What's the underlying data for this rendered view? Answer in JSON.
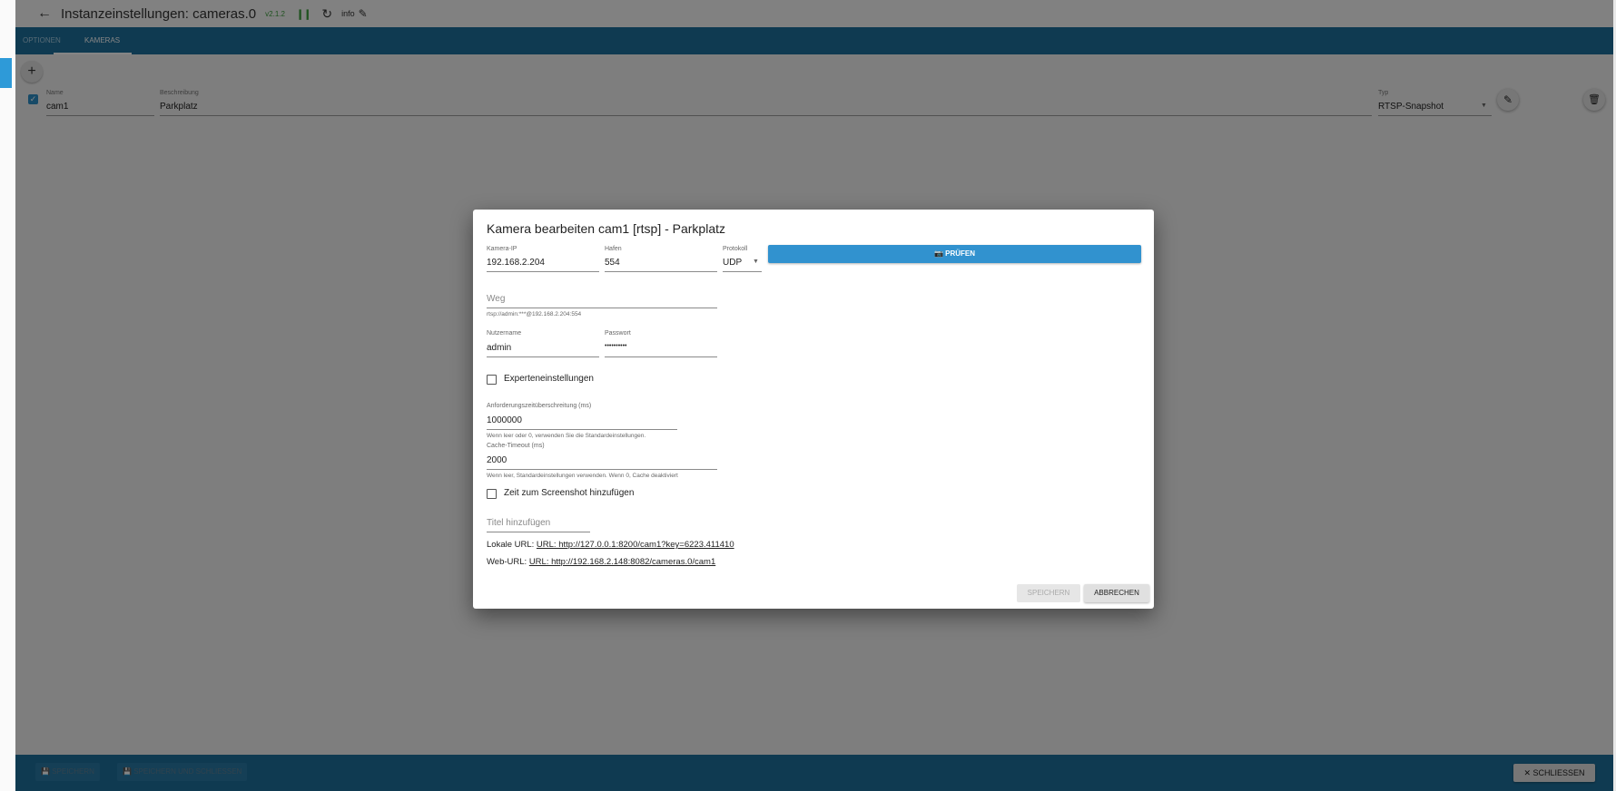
{
  "header": {
    "back_icon": "arrow-left-icon",
    "title": "Instanzeinstellungen: cameras.0",
    "version": "v2.1.2",
    "info_label": "info"
  },
  "tabs": [
    {
      "label": "OPTIONEN",
      "active": false
    },
    {
      "label": "KAMERAS",
      "active": true
    }
  ],
  "camera_row": {
    "checked": true,
    "name_label": "Name",
    "name_value": "cam1",
    "desc_label": "Beschreibung",
    "desc_value": "Parkplatz",
    "type_label": "Typ",
    "type_value": "RTSP-Snapshot"
  },
  "bottom": {
    "save_label": "SPEICHERN",
    "save_close_label": "SPEICHERN UND SCHLIESSEN",
    "close_label": "SCHLIESSEN"
  },
  "dialog": {
    "title": "Kamera bearbeiten cam1 [rtsp] - Parkplatz",
    "ip_label": "Kamera-IP",
    "ip_value": "192.168.2.204",
    "port_label": "Hafen",
    "port_value": "554",
    "protocol_label": "Protokoll",
    "protocol_value": "UDP",
    "test_label": "PRÜFEN",
    "path_placeholder": "Weg",
    "path_helper": "rtsp://admin:***@192.168.2.204:554",
    "user_label": "Nutzername",
    "user_value": "admin",
    "pass_label": "Passwort",
    "pass_value": "••••••••••",
    "expert_label": "Experteneinstellungen",
    "expert_checked": false,
    "timeout_label": "Anforderungszeitüberschreitung (ms)",
    "timeout_value": "1000000",
    "timeout_helper": "Wenn leer oder 0, verwenden Sie die Standardeinstellungen.",
    "cache_label": "Cache-Timeout (ms)",
    "cache_value": "2000",
    "cache_helper": "Wenn leer, Standardeinstellungen verwenden. Wenn 0, Cache deaktiviert",
    "time_label": "Zeit zum Screenshot hinzufügen",
    "time_checked": false,
    "caption_placeholder": "Titel hinzufügen",
    "local_url_label": "Lokale URL:",
    "local_url": "URL: http://127.0.0.1:8200/cam1?key=6223.411410",
    "web_url_label": "Web-URL:",
    "web_url": "URL: http://192.168.2.148:8082/cameras.0/cam1",
    "save_label": "SPEICHERN",
    "cancel_label": "ABBRECHEN"
  },
  "colors": {
    "primary": "#1e6f9b",
    "accent": "#3192cf",
    "status_green": "#3c9d3c"
  }
}
